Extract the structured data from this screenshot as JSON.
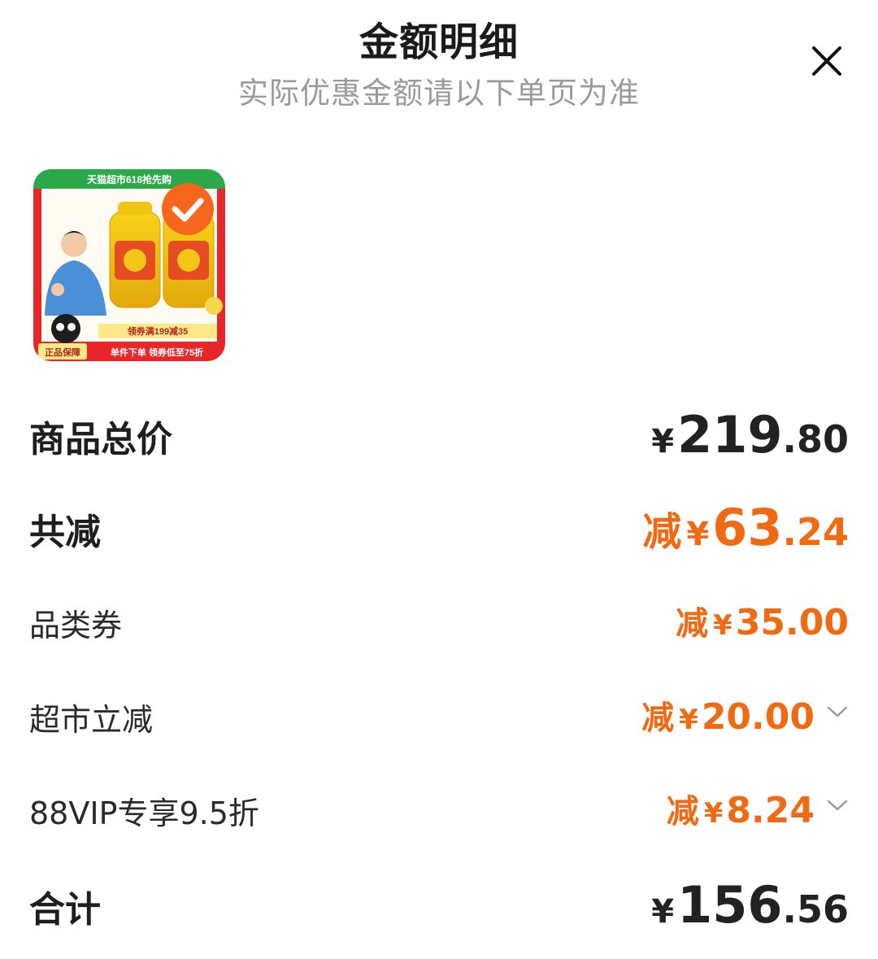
{
  "header": {
    "title": "金额明细",
    "subtitle": "实际优惠金额请以下单页为准",
    "close_icon": "close-icon"
  },
  "product": {
    "image_texts": {
      "banner": "天猫超市618抢先购",
      "coupon": "领券满199减35",
      "guarantee": "正品保障",
      "promo": "单件下单 领券低至75折"
    },
    "selected": true
  },
  "rows": {
    "total_price": {
      "label": "商品总价",
      "yen": "¥",
      "int": "219",
      "dec": ".80"
    },
    "total_discount": {
      "label": "共减",
      "prefix": "减",
      "yen": "¥",
      "int": "63",
      "dec": ".24"
    },
    "category_coupon": {
      "label": "品类券",
      "prefix": "减",
      "yen": "¥",
      "int": "35",
      "dec": ".00"
    },
    "supermarket_discount": {
      "label": "超市立减",
      "prefix": "减",
      "yen": "¥",
      "int": "20",
      "dec": ".00"
    },
    "vip_discount": {
      "label": "88VIP专享9.5折",
      "prefix": "减",
      "yen": "¥",
      "int": "8",
      "dec": ".24"
    },
    "sum": {
      "label": "合计",
      "yen": "¥",
      "int": "156",
      "dec": ".56"
    }
  },
  "colors": {
    "accent": "#f06a13",
    "text": "#222222",
    "muted": "#9a9a9a"
  }
}
